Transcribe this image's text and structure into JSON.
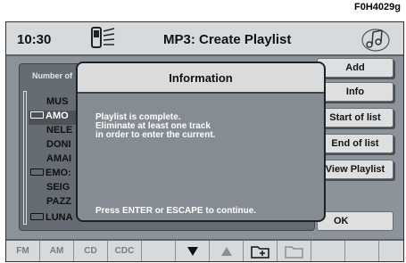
{
  "figure_code": "F0H4029g",
  "header": {
    "time": "10:30",
    "title": "MP3: Create Playlist",
    "phone_icon": "phone-signal-icon",
    "music_icon": "music-notes-icon"
  },
  "left_panel": {
    "number_label": "Number of",
    "items": [
      {
        "label": "MUS",
        "folder": false,
        "selected": false
      },
      {
        "label": "AMO",
        "folder": true,
        "selected": true
      },
      {
        "label": "NELE",
        "folder": false,
        "selected": false
      },
      {
        "label": "DONI",
        "folder": false,
        "selected": false
      },
      {
        "label": "AMAI",
        "folder": false,
        "selected": false
      },
      {
        "label": "EMO:",
        "folder": true,
        "selected": false
      },
      {
        "label": "SEIG",
        "folder": false,
        "selected": false
      },
      {
        "label": "PAZZ",
        "folder": false,
        "selected": false
      },
      {
        "label": "LUNA",
        "folder": true,
        "selected": false
      }
    ]
  },
  "right_buttons": {
    "add": "Add",
    "info": "Info",
    "start": "Start of list",
    "end": "End of list",
    "view": "View Playlist",
    "ok": "OK"
  },
  "dialog": {
    "title": "Information",
    "message": [
      "Playlist is complete.",
      "Eliminate at least one track",
      "in order to enter the current."
    ],
    "footer": "Press ENTER or ESCAPE to continue."
  },
  "bottom_bar": {
    "fm": "FM",
    "am": "AM",
    "cd": "CD",
    "cdc": "CDC",
    "icons": [
      "down-arrow-icon",
      "up-arrow-icon",
      "folder-add-icon",
      "folder-open-icon"
    ]
  }
}
